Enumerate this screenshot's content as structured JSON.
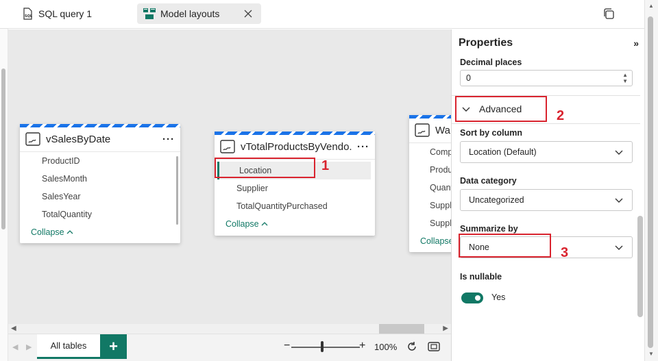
{
  "tabs": [
    {
      "label": "SQL query 1",
      "icon": "sql-file-icon"
    },
    {
      "label": "Model layouts",
      "icon": "model-layout-icon",
      "active": true
    }
  ],
  "tables": [
    {
      "title": "vSalesByDate",
      "fields": [
        "ProductID",
        "SalesMonth",
        "SalesYear",
        "TotalQuantity"
      ],
      "collapse": "Collapse",
      "more": "···"
    },
    {
      "title": "vTotalProductsByVendo...",
      "fields": [
        "Location",
        "Supplier",
        "TotalQuantityPurchased"
      ],
      "collapse": "Collapse",
      "more": "···",
      "selected_field": "Location"
    },
    {
      "title": "War",
      "fields": [
        "Comp",
        "Produ",
        "Quant",
        "Suppl",
        "Suppl"
      ],
      "collapse": "Collapse"
    }
  ],
  "bottom": {
    "tab_label": "All tables",
    "add_label": "+",
    "zoom_minus": "−",
    "zoom_plus": "+",
    "zoom_value": "100%",
    "zoom_fraction": 0.45
  },
  "properties": {
    "title": "Properties",
    "expand": "»",
    "decimal_label": "Decimal places",
    "decimal_value": "0",
    "advanced_label": "Advanced",
    "sort_label": "Sort by column",
    "sort_value": "Location (Default)",
    "category_label": "Data category",
    "category_value": "Uncategorized",
    "summarize_label": "Summarize by",
    "summarize_value": "None",
    "nullable_label": "Is nullable",
    "nullable_value": "Yes"
  },
  "annotations": [
    "1",
    "2",
    "3"
  ],
  "colors": {
    "accent": "#117865",
    "highlight": "#d9232e",
    "stripe": "#1a73e8"
  }
}
